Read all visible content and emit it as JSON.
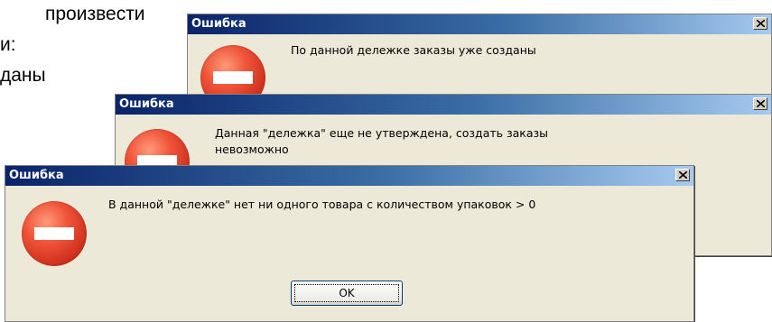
{
  "background_text": {
    "line1": "произвести",
    "line2": "и:",
    "line3": "даны"
  },
  "dialogs": [
    {
      "title": "Ошибка",
      "message": "По данной дележке заказы уже созданы"
    },
    {
      "title": "Ошибка",
      "message_line1": "Данная \"дележка\" еще не утверждена, создать заказы",
      "message_line2": "невозможно"
    },
    {
      "title": "Ошибка",
      "message": "В данной \"дележке\" нет ни одного товара с количеством упаковок > 0",
      "ok_label": "OK"
    }
  ],
  "colors": {
    "titlebar_start": "#0a246a",
    "titlebar_end": "#a6caf0",
    "dialog_bg": "#ece9d8",
    "stop_icon": "#d0321e"
  },
  "icons": {
    "close": "close-x-icon",
    "error": "stop-error-icon"
  }
}
